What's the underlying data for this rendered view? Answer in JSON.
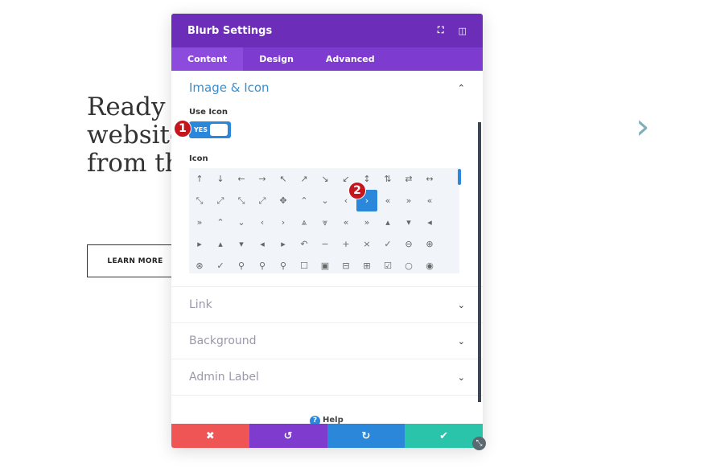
{
  "page": {
    "hero_lines": [
      "Ready to build your",
      "website",
      "from the ground up"
    ],
    "learn_more": "LEARN MORE",
    "next_icon": "chevron-right-icon"
  },
  "modal": {
    "title": "Blurb Settings",
    "header_icons": [
      "fullscreen-icon",
      "sidebar-toggle-icon"
    ],
    "tabs": [
      {
        "label": "Content",
        "active": true
      },
      {
        "label": "Design"
      },
      {
        "label": "Advanced"
      }
    ],
    "image_icon": {
      "title": "Image & Icon",
      "use_icon_label": "Use Icon",
      "toggle_value": "YES",
      "icon_label": "Icon",
      "icons": [
        "↑",
        "↓",
        "←",
        "→",
        "↖",
        "↗",
        "↘",
        "↙",
        "↕",
        "⇅",
        "⇄",
        "↔",
        "",
        "⤡",
        "⤢",
        "⤡",
        "⤢",
        "✥",
        "⌃",
        "⌄",
        "‹",
        "›",
        "«",
        "»",
        "«",
        "",
        "»",
        "⌃",
        "⌄",
        "‹",
        "›",
        "⩓",
        "⩔",
        "«",
        "»",
        "▴",
        "▾",
        "◂",
        "",
        "▸",
        "▴",
        "▾",
        "◂",
        "▸",
        "↶",
        "−",
        "+",
        "×",
        "✓",
        "⊖",
        "⊕",
        "",
        "⊗",
        "✓",
        "⚲",
        "⚲",
        "⚲",
        "☐",
        "▣",
        "⊟",
        "⊞",
        "☑",
        "○",
        "◉",
        ""
      ],
      "selected_index": 21
    },
    "sections": [
      "Link",
      "Background",
      "Admin Label"
    ],
    "help": "Help",
    "footer": {
      "cancel": "✖",
      "undo": "↺",
      "redo": "↻",
      "save": "✔"
    },
    "colors": {
      "header": "#6c2eb9",
      "tabs": "#7e3bd0",
      "cancel": "#ef5555",
      "undo": "#7f3bce",
      "redo": "#2b87da",
      "save": "#29c4a9"
    },
    "annotations": [
      "1",
      "2"
    ]
  }
}
